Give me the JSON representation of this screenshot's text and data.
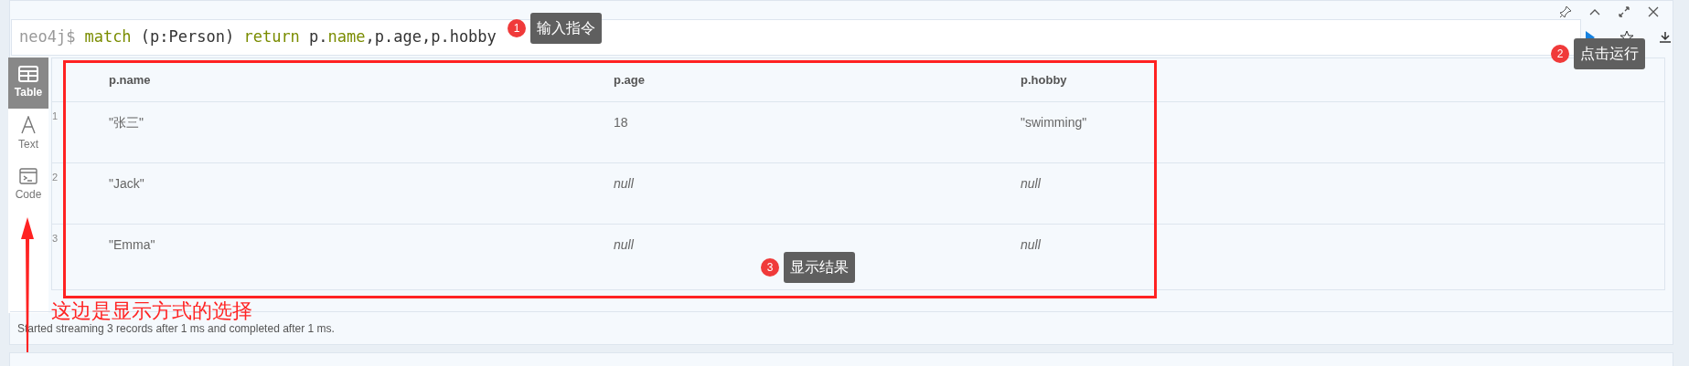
{
  "editor": {
    "prompt": "neo4j$",
    "tokens": [
      {
        "text": "match",
        "kind": "keyword"
      },
      {
        "text": " (p:Person) ",
        "kind": "plain"
      },
      {
        "text": "return",
        "kind": "keyword"
      },
      {
        "text": " p.",
        "kind": "plain"
      },
      {
        "text": "name",
        "kind": "keyword"
      },
      {
        "text": ",p.age,p.hobby",
        "kind": "plain"
      }
    ]
  },
  "view_tabs": [
    {
      "label": "Table",
      "kind": "table",
      "selected": true
    },
    {
      "label": "Text",
      "kind": "text",
      "selected": false
    },
    {
      "label": "Code",
      "kind": "code",
      "selected": false
    }
  ],
  "table": {
    "columns": [
      "p.name",
      "p.age",
      "p.hobby"
    ],
    "rows": [
      {
        "number": "1",
        "cells": [
          {
            "text": "\"张三\"",
            "kind": "value"
          },
          {
            "text": "18",
            "kind": "value"
          },
          {
            "text": "\"swimming\"",
            "kind": "value"
          }
        ]
      },
      {
        "number": "2",
        "cells": [
          {
            "text": "\"Jack\"",
            "kind": "value"
          },
          {
            "text": "null",
            "kind": "null"
          },
          {
            "text": "null",
            "kind": "null"
          }
        ]
      },
      {
        "number": "3",
        "cells": [
          {
            "text": "\"Emma\"",
            "kind": "value"
          },
          {
            "text": "null",
            "kind": "null"
          },
          {
            "text": "null",
            "kind": "null"
          }
        ]
      }
    ]
  },
  "status": "Started streaming 3 records after 1 ms and completed after 1 ms.",
  "annotations": [
    {
      "number": "1",
      "label": "输入指令"
    },
    {
      "number": "2",
      "label": "点击运行"
    },
    {
      "number": "3",
      "label": "显示结果"
    }
  ],
  "note": "这边是显示方式的选择"
}
